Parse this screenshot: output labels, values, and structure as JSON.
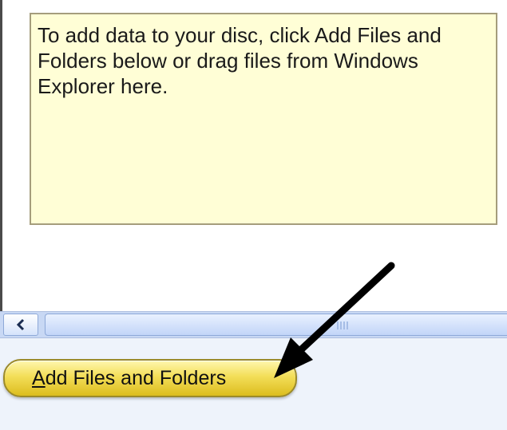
{
  "drop_area": {
    "hint_text": "To add data to your disc, click Add Files and Folders below or drag files from Windows Explorer here."
  },
  "scrollbar": {
    "left_button_icon": "chevron-left-icon"
  },
  "actions": {
    "add_button_label": "Add Files and Folders",
    "add_button_mnemonic": "A"
  },
  "annotation": {
    "arrow_icon": "black-pointer-arrow-icon"
  },
  "colors": {
    "hint_background": "#fffed6",
    "button_gold": "#f3de58",
    "scrollbar_blue": "#c8d8f4",
    "arrow": "#000000"
  }
}
